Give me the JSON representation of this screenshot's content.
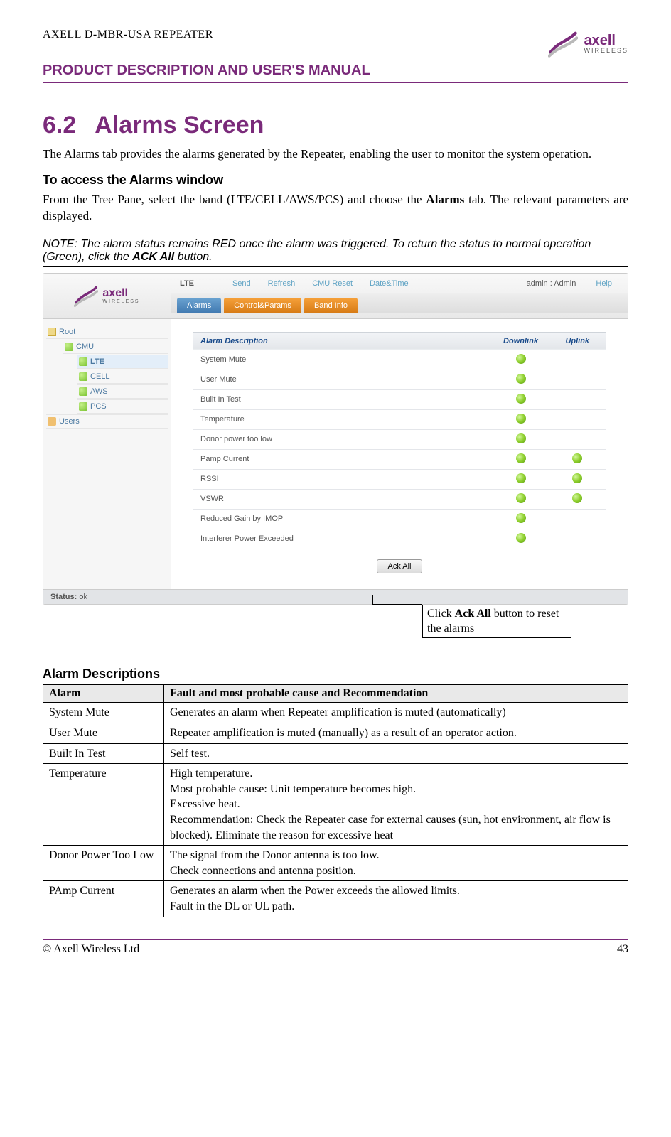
{
  "header": {
    "product_line": "AXELL D-MBR-USA REPEATER",
    "manual_title": "PRODUCT DESCRIPTION AND USER'S MANUAL",
    "logo_name": "axell",
    "logo_sub": "WIRELESS"
  },
  "section": {
    "number": "6.2",
    "title": "Alarms Screen",
    "intro": "The Alarms tab provides the alarms generated by the Repeater, enabling the user to monitor the system operation.",
    "access_heading": "To access the Alarms window",
    "access_body_1": "From the Tree Pane, select the band (LTE/CELL/AWS/PCS) and choose the ",
    "access_body_bold": "Alarms",
    "access_body_2": " tab. The relevant parameters are displayed.",
    "note_prefix": "NOTE: The alarm status remains RED once the alarm was triggered. To return the status to normal operation (Green), click the ",
    "note_bold": "ACK All",
    "note_suffix": " button."
  },
  "screenshot": {
    "band_label": "LTE",
    "menu": {
      "send": "Send",
      "refresh": "Refresh",
      "cmu_reset": "CMU Reset",
      "date_time": "Date&Time",
      "admin": "admin : Admin",
      "help": "Help"
    },
    "tabs": {
      "alarms": "Alarms",
      "control": "Control&Params",
      "band_info": "Band Info"
    },
    "tree": {
      "root": "Root",
      "cmu": "CMU",
      "lte": "LTE",
      "cell": "CELL",
      "aws": "AWS",
      "pcs": "PCS",
      "users": "Users"
    },
    "table": {
      "col_desc": "Alarm Description",
      "col_dn": "Downlink",
      "col_up": "Uplink",
      "rows": [
        {
          "desc": "System Mute",
          "dn": true,
          "up": false
        },
        {
          "desc": "User Mute",
          "dn": true,
          "up": false
        },
        {
          "desc": "Built In Test",
          "dn": true,
          "up": false
        },
        {
          "desc": "Temperature",
          "dn": true,
          "up": false
        },
        {
          "desc": "Donor power too low",
          "dn": true,
          "up": false
        },
        {
          "desc": "Pamp Current",
          "dn": true,
          "up": true
        },
        {
          "desc": "RSSI",
          "dn": true,
          "up": true
        },
        {
          "desc": "VSWR",
          "dn": true,
          "up": true
        },
        {
          "desc": "Reduced Gain by IMOP",
          "dn": true,
          "up": false
        },
        {
          "desc": "Interferer Power Exceeded",
          "dn": true,
          "up": false
        }
      ]
    },
    "ack_all": "Ack All",
    "status_label": "Status:",
    "status_value": "ok",
    "callout_1": "Click ",
    "callout_bold": "Ack All",
    "callout_2": " button to reset the alarms"
  },
  "alarm_desc": {
    "heading": "Alarm Descriptions",
    "col_alarm": "Alarm",
    "col_fault": "Fault and most probable cause and Recommendation",
    "rows": [
      {
        "name": "System Mute",
        "text": "Generates an alarm when Repeater amplification is muted (automatically)"
      },
      {
        "name": "User Mute",
        "text": "Repeater amplification is muted (manually) as a result of an operator action."
      },
      {
        "name": "Built In Test",
        "text": "Self test."
      },
      {
        "name": "Temperature",
        "text": "High temperature.\nMost probable cause: Unit temperature becomes high.\nExcessive heat.\nRecommendation: Check the Repeater case for external causes (sun, hot environment, air flow is blocked). Eliminate the reason for excessive heat"
      },
      {
        "name": "Donor Power Too Low",
        "text": "The signal from the Donor antenna is too low.\nCheck connections and antenna position."
      },
      {
        "name": "PAmp Current",
        "text": "Generates an alarm when the Power exceeds the allowed limits.\nFault in the DL or UL path."
      }
    ]
  },
  "footer": {
    "copyright": "© Axell Wireless Ltd",
    "page": "43"
  }
}
